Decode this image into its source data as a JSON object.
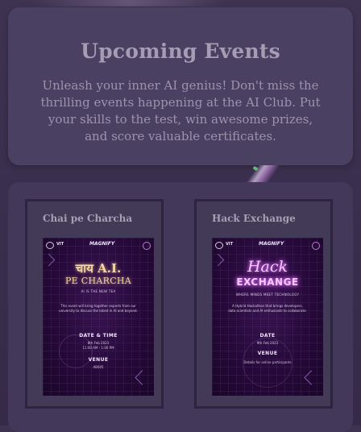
{
  "header": {
    "title": "Upcoming Events",
    "description": "Unleash your inner AI genius! Don't miss the thrilling events happening at the AI Club. Put your skills to the test, win awesome prizes, and score valuable certificates."
  },
  "events": [
    {
      "name": "Chai pe Charcha",
      "poster": {
        "logo_left": "VIT",
        "logo_center": "MAGNIFY",
        "title_line1": "चाय A.I.",
        "title_line2": "PE CHARCHA",
        "tagline": "AI IS THE NEW TEA",
        "body_line1": "This event will bring together experts from our",
        "body_line2": "university to discuss the latest in AI and beyond.",
        "section1_head": "DATE & TIME",
        "section1_line1": "8th Feb 2023",
        "section1_line2": "11:00 AM - 1:00 PM",
        "section2_head": "VENUE",
        "section2_line1": "AB005"
      }
    },
    {
      "name": "Hack Exchange",
      "poster": {
        "logo_left": "VIT",
        "logo_center": "MAGNIFY",
        "title_line1": "Hack",
        "title_line2": "EXCHANGE",
        "tagline": "WHERE MINDS MEET TECHNOLOGY",
        "body_line1": "A Hybrid Hackathon that brings developers,",
        "body_line2": "data scientists and AI enthusiasts to collaborate.",
        "section1_head": "DATE",
        "section1_line1": "9th Feb 2023",
        "section1_line2": "",
        "section2_head": "VENUE",
        "section2_line1": "Details for online participants"
      }
    }
  ],
  "colors": {
    "page_bg": "#3a2f4e",
    "header_card_bg": "#4a4061",
    "title_text": "#a69cb4",
    "poster_bg": "#26093a",
    "neon_pink": "#e27bff",
    "warm_gold": "#f2d7a0"
  }
}
